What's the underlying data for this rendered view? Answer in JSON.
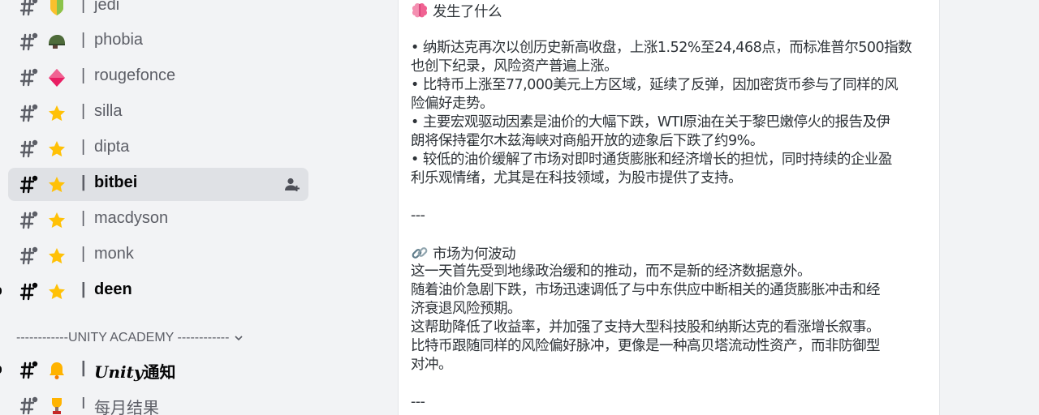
{
  "sidebar": {
    "channels": [
      {
        "emoji": "shield-badge-icon",
        "name": "jedi",
        "sep": "|"
      },
      {
        "emoji": "military-helmet-icon",
        "name": "phobia",
        "sep": "|"
      },
      {
        "emoji": "diamond-icon",
        "name": "rougefonce",
        "sep": "|"
      },
      {
        "emoji": "star-icon",
        "name": "silla",
        "sep": "|"
      },
      {
        "emoji": "star-icon",
        "name": "dipta",
        "sep": "|"
      },
      {
        "emoji": "star-icon",
        "name": "bitbei",
        "sep": "|"
      },
      {
        "emoji": "star-icon",
        "name": "macdyson",
        "sep": "|"
      },
      {
        "emoji": "star-icon",
        "name": "monk",
        "sep": "|"
      },
      {
        "emoji": "star-icon",
        "name": "deen",
        "sep": "|"
      }
    ],
    "category": "------------UNITY ACADEMY ------------",
    "unity_channels": [
      {
        "emoji": "bell-icon",
        "name_italic": "Unity",
        "name": "通知",
        "sep": "|"
      },
      {
        "emoji": "trophy-icon",
        "name": "每月结果",
        "sep": "I"
      }
    ]
  },
  "message": {
    "section1_title": "发生了什么",
    "section1_lines": [
      "• 纳斯达克再次以创历史新高收盘，上涨1.52%至24,468点，而标准普尔500指数",
      "也创下纪录，风险资产普遍上涨。",
      "• 比特币上涨至77,000美元上方区域，延续了反弹，因加密货币参与了同样的风",
      "险偏好走势。",
      "• 主要宏观驱动因素是油价的大幅下跌，WTI原油在关于黎巴嫩停火的报告及伊",
      "朗将保持霍尔木兹海峡对商船开放的迹象后下跌了约9%。",
      "• 较低的油价缓解了市场对即时通货膨胀和经济增长的担忧，同时持续的企业盈",
      "利乐观情绪，尤其是在科技领域，为股市提供了支持。"
    ],
    "divider": "---",
    "section2_title": "市场为何波动",
    "section2_lines": [
      "这一天首先受到地缘政治缓和的推动，而不是新的经济数据意外。",
      "随着油价急剧下跌，市场迅速调低了与中东供应中断相关的通货膨胀冲击和经",
      "济衰退风险预期。",
      "这帮助降低了收益率，并加强了支持大型科技股和纳斯达克的看涨增长叙事。",
      "比特币跟随同样的风险偏好脉冲，更像是一种高贝塔流动性资产，而非防御型",
      "对冲。"
    ],
    "divider2": "---"
  }
}
